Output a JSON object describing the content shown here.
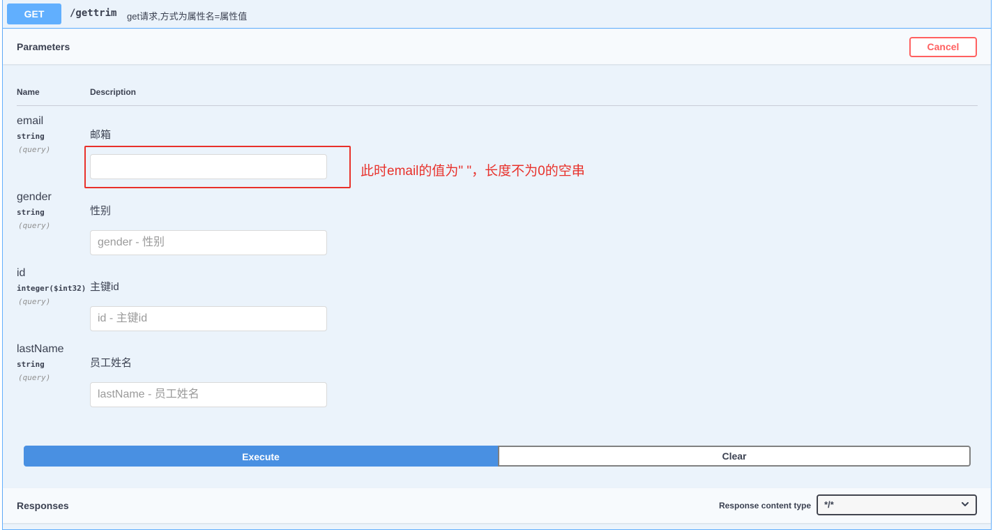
{
  "summary": {
    "method": "GET",
    "path": "/gettrim",
    "description": "get请求,方式为属性名=属性值"
  },
  "parameters": {
    "title": "Parameters",
    "cancel_label": "Cancel",
    "col_name": "Name",
    "col_description": "Description",
    "items": [
      {
        "name": "email",
        "type": "string",
        "in": "(query)",
        "description": "邮箱",
        "value": "",
        "placeholder": ""
      },
      {
        "name": "gender",
        "type": "string",
        "in": "(query)",
        "description": "性别",
        "value": "",
        "placeholder": "gender - 性别"
      },
      {
        "name": "id",
        "type": "integer($int32)",
        "in": "(query)",
        "description": "主键id",
        "value": "",
        "placeholder": "id - 主键id"
      },
      {
        "name": "lastName",
        "type": "string",
        "in": "(query)",
        "description": "员工姓名",
        "value": "",
        "placeholder": "lastName - 员工姓名"
      }
    ]
  },
  "annotation": {
    "text": "此时email的值为\" \"，长度不为0的空串",
    "color": "#e8302a"
  },
  "actions": {
    "execute_label": "Execute",
    "clear_label": "Clear"
  },
  "responses": {
    "title": "Responses",
    "content_type_label": "Response content type",
    "content_type_value": "*/*",
    "icon": "chevron-down-icon"
  },
  "colors": {
    "get_accent": "#61affe",
    "execute": "#4990e2",
    "cancel": "#ff6060",
    "block_bg": "#ebf3fb"
  }
}
